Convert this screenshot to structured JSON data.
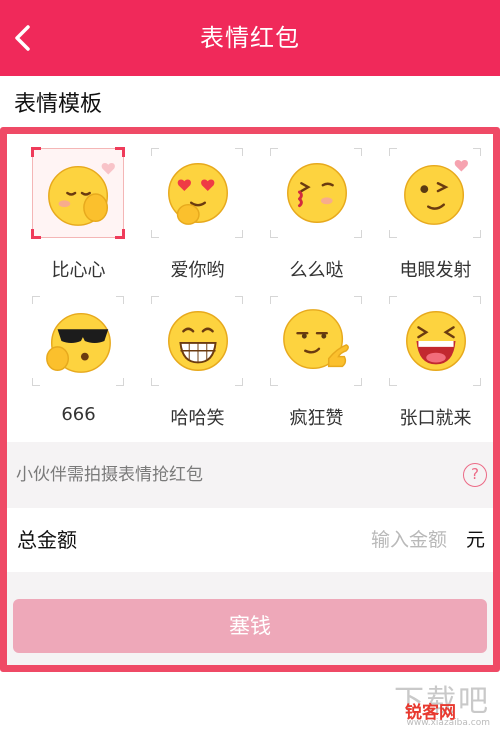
{
  "header": {
    "title": "表情红包",
    "back_icon": "back-arrow-icon"
  },
  "section_label": "表情模板",
  "templates": [
    {
      "label": "比心心",
      "icon": "finger-heart-emoji-icon",
      "selected": true
    },
    {
      "label": "爱你哟",
      "icon": "heart-eyes-emoji-icon",
      "selected": false
    },
    {
      "label": "么么哒",
      "icon": "kiss-emoji-icon",
      "selected": false
    },
    {
      "label": "电眼发射",
      "icon": "wink-heart-emoji-icon",
      "selected": false
    },
    {
      "label": "666",
      "icon": "sunglasses-666-emoji-icon",
      "selected": false
    },
    {
      "label": "哈哈笑",
      "icon": "grin-emoji-icon",
      "selected": false
    },
    {
      "label": "疯狂赞",
      "icon": "thumbs-up-emoji-icon",
      "selected": false
    },
    {
      "label": "张口就来",
      "icon": "laughing-open-mouth-emoji-icon",
      "selected": false
    }
  ],
  "hint": {
    "text": "小伙伴需拍摄表情抢红包",
    "help_symbol": "?"
  },
  "amount": {
    "label": "总金额",
    "placeholder": "输入金额",
    "unit": "元"
  },
  "submit_label": "塞钱",
  "watermark": {
    "brand": "锐客网",
    "site": "www.xiazaiba.com",
    "brand_mark": "下载吧"
  },
  "colors": {
    "header": "#f0295a",
    "frame_border": "#ef4a66",
    "submit_bg": "#eea8b9",
    "face": "#fdd33f"
  }
}
